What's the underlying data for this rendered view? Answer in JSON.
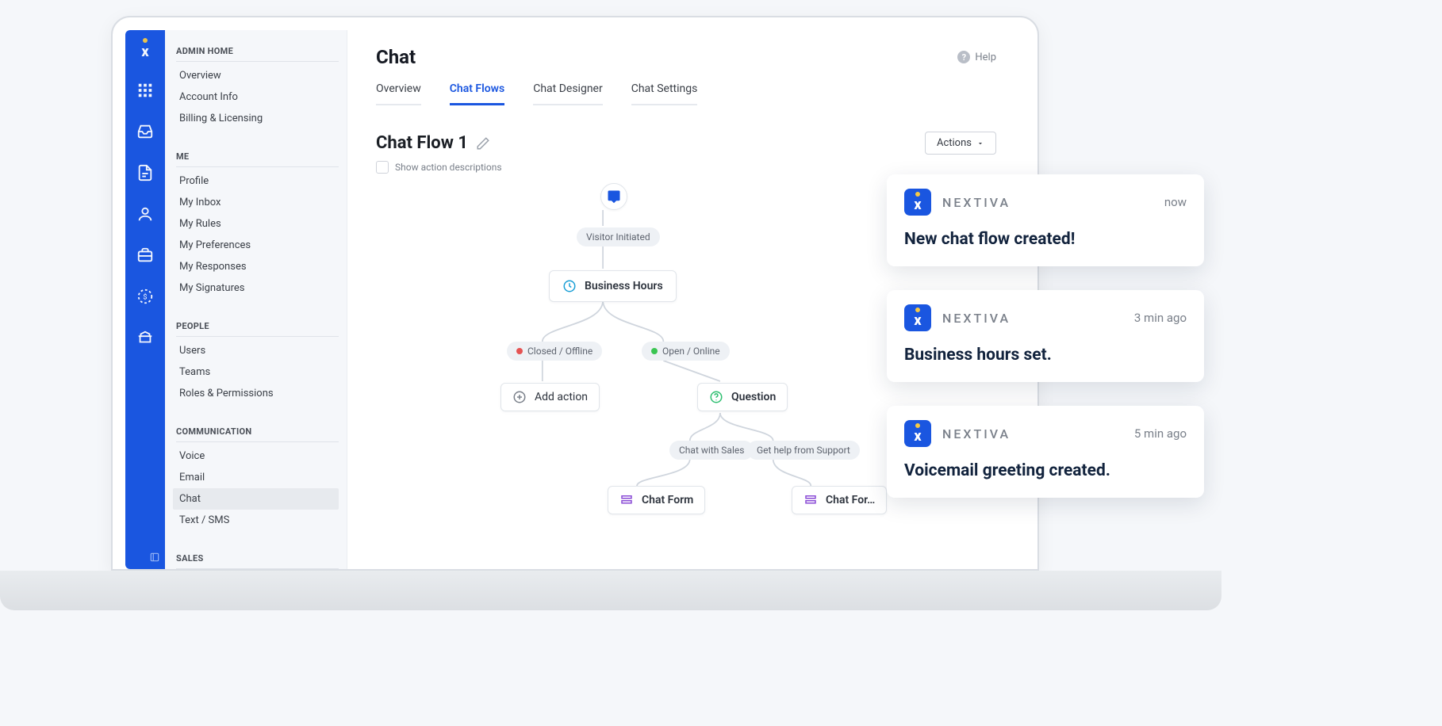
{
  "sidebar": {
    "sections": [
      {
        "title": "ADMIN HOME",
        "items": [
          "Overview",
          "Account Info",
          "Billing & Licensing"
        ]
      },
      {
        "title": "ME",
        "items": [
          "Profile",
          "My Inbox",
          "My Rules",
          "My Preferences",
          "My Responses",
          "My Signatures"
        ]
      },
      {
        "title": "PEOPLE",
        "items": [
          "Users",
          "Teams",
          "Roles & Permissions"
        ]
      },
      {
        "title": "COMMUNICATION",
        "items": [
          "Voice",
          "Email",
          "Chat",
          "Text / SMS"
        ],
        "active": "Chat"
      },
      {
        "title": "SALES",
        "items": []
      }
    ]
  },
  "header": {
    "title": "Chat",
    "help_label": "Help"
  },
  "tabs": {
    "items": [
      "Overview",
      "Chat Flows",
      "Chat Designer",
      "Chat Settings"
    ],
    "active": "Chat Flows"
  },
  "flow": {
    "title": "Chat Flow 1",
    "show_descriptions_label": "Show action descriptions",
    "actions_button": "Actions",
    "nodes": {
      "visitor_initiated": "Visitor Initiated",
      "business_hours": "Business Hours",
      "closed_offline": "Closed / Offline",
      "open_online": "Open / Online",
      "add_action": "Add action",
      "question": "Question",
      "chat_with_sales": "Chat with Sales",
      "get_help_support": "Get help from Support",
      "chat_form_left": "Chat Form",
      "chat_form_right": "Chat For…"
    }
  },
  "toasts": [
    {
      "brand": "NEXTIVA",
      "time": "now",
      "message": "New chat flow created!"
    },
    {
      "brand": "NEXTIVA",
      "time": "3 min ago",
      "message": "Business hours set."
    },
    {
      "brand": "NEXTIVA",
      "time": "5 min ago",
      "message": "Voicemail greeting created."
    }
  ]
}
